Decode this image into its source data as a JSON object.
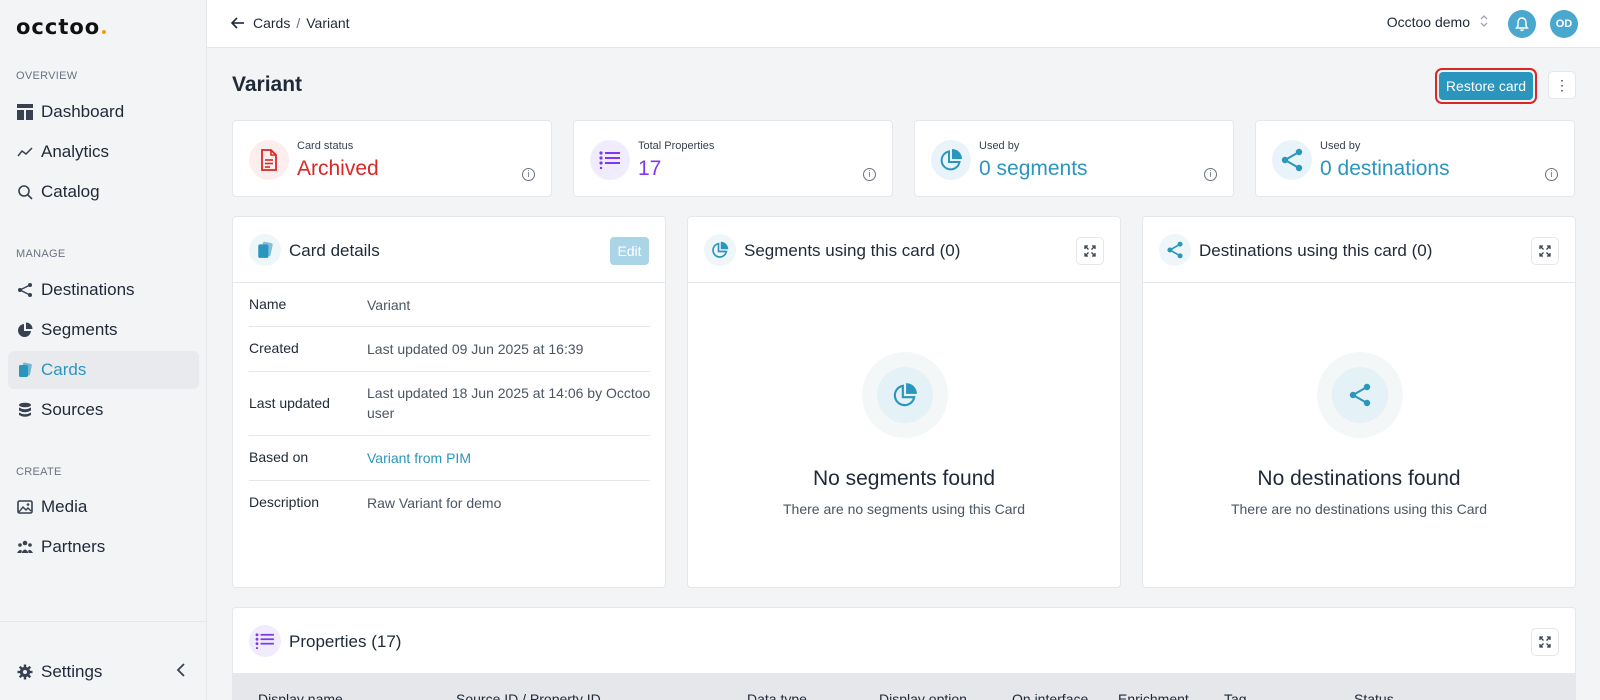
{
  "app": {
    "logo": "occtoo"
  },
  "sidebar": {
    "sections": [
      {
        "label": "OVERVIEW"
      },
      {
        "label": "MANAGE"
      },
      {
        "label": "CREATE"
      }
    ],
    "items": [
      {
        "label": "Dashboard"
      },
      {
        "label": "Analytics"
      },
      {
        "label": "Catalog"
      },
      {
        "label": "Destinations"
      },
      {
        "label": "Segments"
      },
      {
        "label": "Cards",
        "active": true
      },
      {
        "label": "Sources"
      },
      {
        "label": "Media"
      },
      {
        "label": "Partners"
      }
    ],
    "settings_label": "Settings"
  },
  "topbar": {
    "breadcrumb": [
      "Cards",
      "Variant"
    ],
    "organization": "Occtoo demo",
    "avatar_initials": "OD"
  },
  "page": {
    "title": "Variant",
    "restore_label": "Restore card",
    "more_label": "⋮"
  },
  "stats": [
    {
      "label": "Card status",
      "value": "Archived",
      "color": "#dc2626",
      "icon": "document-icon"
    },
    {
      "label": "Total Properties",
      "value": "17",
      "color": "#7c3aed",
      "icon": "list-icon"
    },
    {
      "label": "Used by",
      "value": "0 segments",
      "color": "#2b96bd",
      "icon": "pie-chart-icon"
    },
    {
      "label": "Used by",
      "value": "0 destinations",
      "color": "#2b96bd",
      "icon": "share-icon"
    }
  ],
  "card_details": {
    "title": "Card details",
    "edit_label": "Edit",
    "rows": [
      {
        "label": "Name",
        "value": "Variant"
      },
      {
        "label": "Created",
        "value": "Last updated 09 Jun 2025 at 16:39"
      },
      {
        "label": "Last updated",
        "value": "Last updated 18 Jun 2025 at 14:06 by Occtoo user"
      },
      {
        "label": "Based on",
        "value": "Variant from PIM"
      },
      {
        "label": "Description",
        "value": "Raw Variant for demo"
      }
    ]
  },
  "segments_panel": {
    "title": "Segments using this card (0)",
    "empty_title": "No segments found",
    "empty_sub": "There are no segments using this Card"
  },
  "destinations_panel": {
    "title": "Destinations using this card (0)",
    "empty_title": "No destinations found",
    "empty_sub": "There are no destinations using this Card"
  },
  "properties": {
    "title": "Properties (17)",
    "columns": [
      "Display name",
      "Source ID / Property ID",
      "Data type",
      "Display option",
      "On interface",
      "Enrichment",
      "Tag",
      "Status"
    ]
  },
  "colors": {
    "accent": "#2b96bd",
    "danger": "#dc2626",
    "purple": "#7c3aed"
  }
}
